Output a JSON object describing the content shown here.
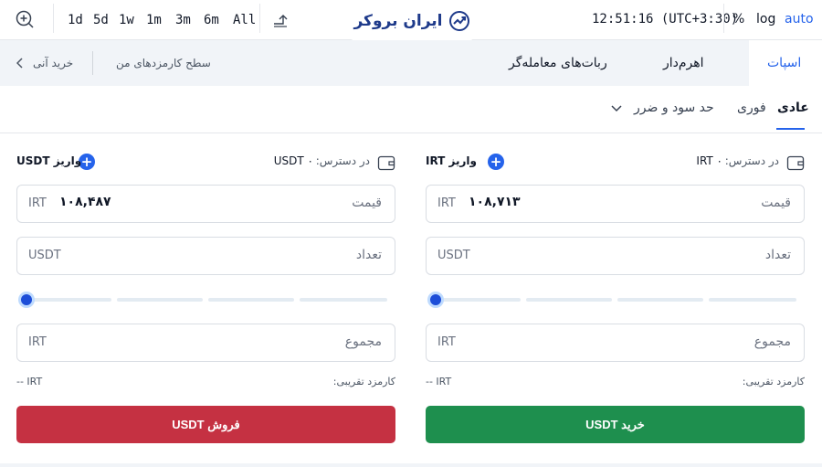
{
  "toolbar": {
    "timeframes": [
      "1d",
      "5d",
      "1w",
      "1m",
      "3m",
      "6m",
      "All"
    ],
    "clock": "12:51:16 (UTC+3:30)",
    "percent_label": "%",
    "log_label": "log",
    "auto_label": "auto"
  },
  "logo": {
    "text": "ایران بروکر"
  },
  "nav": {
    "tabs": [
      {
        "label": "اسپات",
        "active": true
      },
      {
        "label": "اهرم‌دار",
        "active": false
      },
      {
        "label": "ربات‌های معامله‌گر",
        "active": false
      }
    ],
    "fee_level_link": "سطح کارمزدهای من",
    "instant_buy_link": "خرید آنی"
  },
  "order_types": {
    "normal": "عادی",
    "instant": "فوری",
    "tp_sl": "حد سود و ضرر"
  },
  "buy": {
    "available_label": "در دسترس:",
    "available_amount": "IRT ۰",
    "deposit_label": "واریز IRT",
    "price_label": "قیمت",
    "price_value": "۱۰۸,۷۱۳",
    "price_unit": "IRT",
    "amount_label": "تعداد",
    "amount_unit": "USDT",
    "total_label": "مجموع",
    "total_unit": "IRT",
    "fee_label": "کارمزد تقریبی:",
    "fee_value": "-- IRT",
    "slider_percent": 0,
    "button_label": "خرید USDT",
    "color": "#1e8f4e"
  },
  "sell": {
    "available_label": "در دسترس:",
    "available_amount": "USDT ۰",
    "deposit_label": "واریز USDT",
    "price_label": "قیمت",
    "price_value": "۱۰۸,۴۸۷",
    "price_unit": "IRT",
    "amount_label": "تعداد",
    "amount_unit": "USDT",
    "total_label": "مجموع",
    "total_unit": "IRT",
    "fee_label": "کارمزد تقریبی:",
    "fee_value": "-- IRT",
    "slider_percent": 0,
    "button_label": "فروش USDT",
    "color": "#c53142"
  },
  "icons": {
    "zoom": "zoom-in-icon",
    "undo": "undo-icon",
    "wallet": "wallet-icon",
    "deposit": "plus-circle-icon",
    "chevron_down": "chevron-down-icon",
    "chevron_left": "chevron-left-icon",
    "logo_mark": "trend-up-logo-icon"
  },
  "colors": {
    "accent": "#2563eb",
    "buy": "#1e8f4e",
    "sell": "#c53142"
  }
}
